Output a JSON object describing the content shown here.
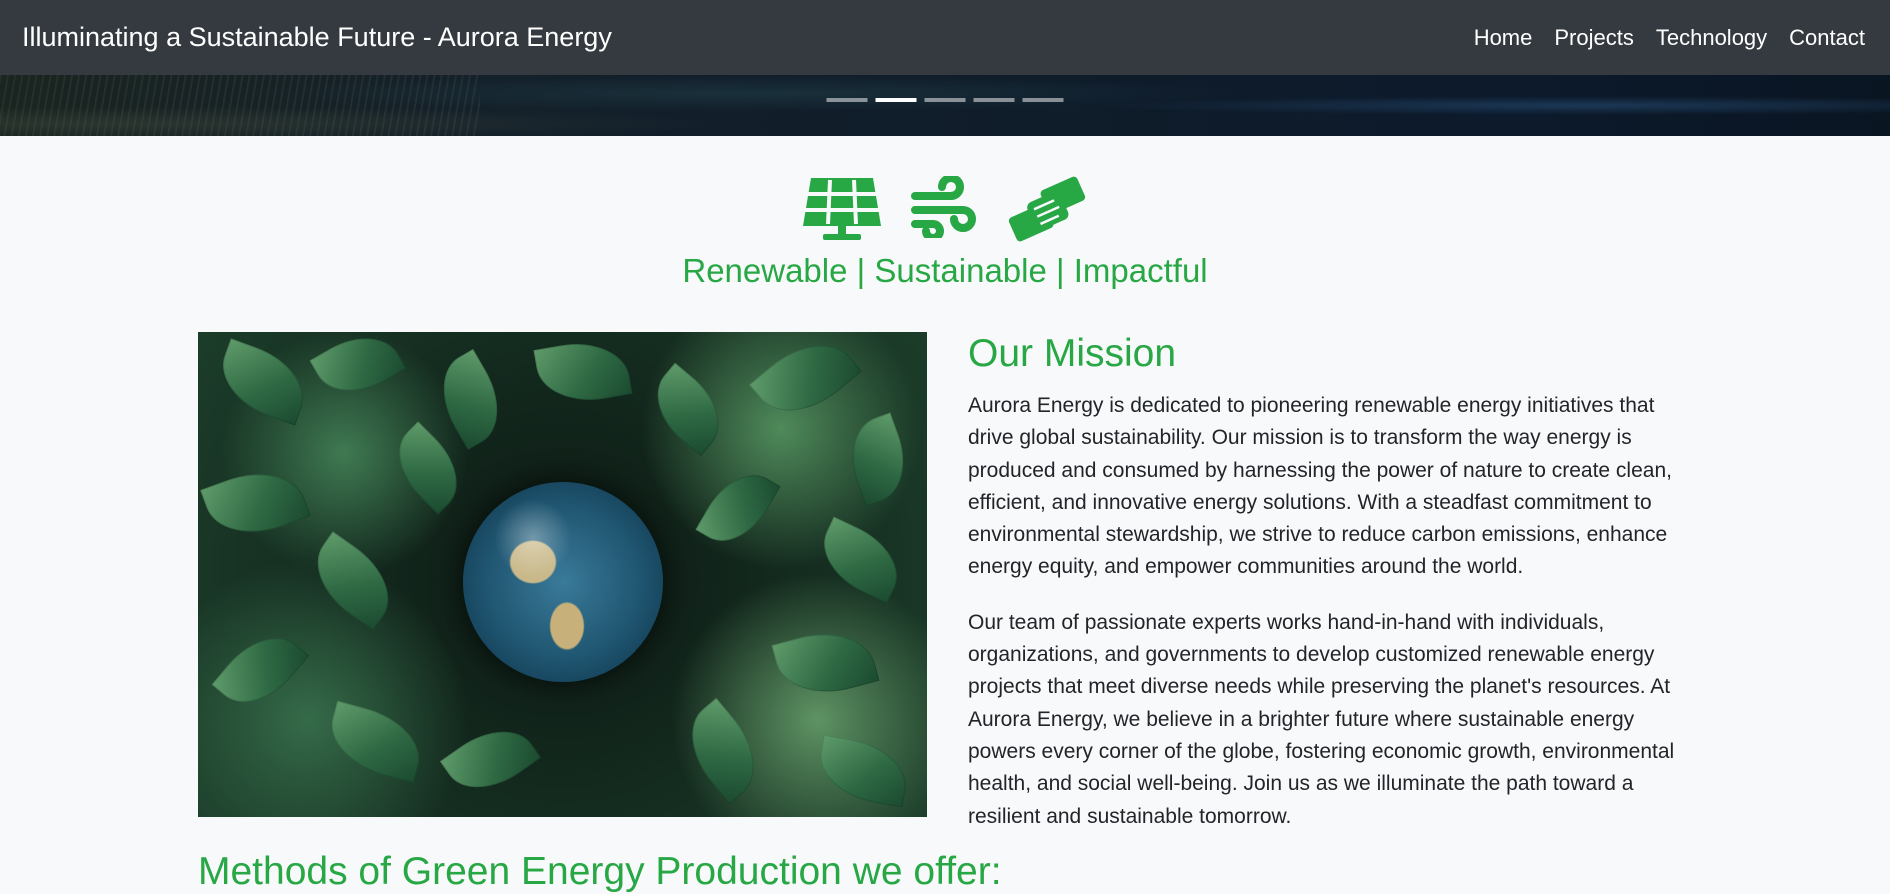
{
  "navbar": {
    "brand": "Illuminating a Sustainable Future - Aurora Energy",
    "links": [
      "Home",
      "Projects",
      "Technology",
      "Contact"
    ]
  },
  "carousel": {
    "slide_count": 5,
    "active_index": 1
  },
  "icons": [
    "solar-panel-icon",
    "wind-icon",
    "handshake-icon"
  ],
  "tagline": "Renewable | Sustainable | Impactful",
  "mission": {
    "title": "Our Mission",
    "paragraphs": [
      "Aurora Energy is dedicated to pioneering renewable energy initiatives that drive global sustainability. Our mission is to transform the way energy is produced and consumed by harnessing the power of nature to create clean, efficient, and innovative energy solutions. With a steadfast commitment to environmental stewardship, we strive to reduce carbon emissions, enhance energy equity, and empower communities around the world.",
      "Our team of passionate experts works hand-in-hand with individuals, organizations, and governments to develop customized renewable energy projects that meet diverse needs while preserving the planet's resources. At Aurora Energy, we believe in a brighter future where sustainable energy powers every corner of the globe, fostering economic growth, environmental health, and social well-being. Join us as we illuminate the path toward a resilient and sustainable tomorrow."
    ]
  },
  "methods": {
    "title": "Methods of Green Energy Production we offer:"
  },
  "colors": {
    "navbar_bg": "#343a40",
    "accent_green": "#28a745",
    "page_bg": "#f8f9fa",
    "body_text": "#212529"
  }
}
